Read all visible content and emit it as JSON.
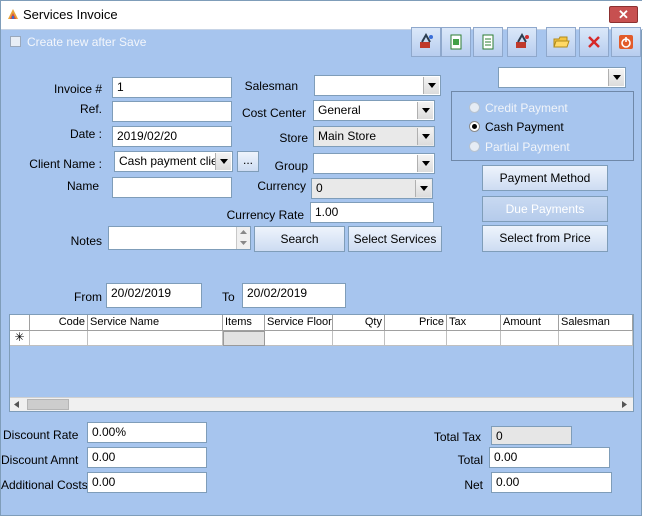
{
  "window": {
    "title": "Services Invoice",
    "close_glyph": "✕"
  },
  "toolbar": {
    "create_new_after_save": "Create new after Save",
    "buttons": [
      "attach-icon",
      "new-doc-icon",
      "save-doc-icon",
      "attach-red-icon",
      "open-folder-icon",
      "delete-icon",
      "power-icon"
    ]
  },
  "form": {
    "invoice_label": "Invoice #",
    "invoice_value": "1",
    "ref_label": "Ref.",
    "ref_value": "",
    "date_label": "Date :",
    "date_value": "2019/02/20",
    "client_label": "Client Name :",
    "client_value": "Cash payment client",
    "client_more": "...",
    "name_label": "Name",
    "name_value": "",
    "notes_label": "Notes",
    "notes_value": "",
    "salesman_label": "Salesman",
    "salesman_value": "",
    "cost_center_label": "Cost Center",
    "cost_center_value": "General",
    "store_label": "Store",
    "store_value": "Main Store",
    "group_label": "Group",
    "group_value": "",
    "currency_label": "Currency",
    "currency_value": "0",
    "currency_rate_label": "Currency Rate",
    "currency_rate_value": "1.00",
    "search_button": "Search",
    "select_services_button": "Select Services"
  },
  "payment": {
    "top_combo_value": "",
    "credit": "Credit Payment",
    "cash": "Cash Payment",
    "partial": "Partial Payment",
    "payment_method_button": "Payment Method",
    "due_payments_button": "Due Payments",
    "select_price_button": "Select from Price"
  },
  "range": {
    "from_label": "From",
    "from_value": "20/02/2019",
    "to_label": "To",
    "to_value": "20/02/2019"
  },
  "grid": {
    "columns": [
      "Code",
      "Service Name",
      "Items",
      "Service Floor",
      "Qty",
      "Price",
      "Tax",
      "Amount",
      "Salesman"
    ],
    "new_row_marker": "✳"
  },
  "totals": {
    "discount_rate_label": "Discount Rate",
    "discount_rate_value": "0.00%",
    "discount_amnt_label": "Discount Amnt",
    "discount_amnt_value": "0.00",
    "additional_costs_label": "Additional Costs",
    "additional_costs_value": "0.00",
    "total_tax_label": "Total Tax",
    "total_tax_value": "0",
    "total_label": "Total",
    "total_value": "0.00",
    "net_label": "Net",
    "net_value": "0.00"
  }
}
